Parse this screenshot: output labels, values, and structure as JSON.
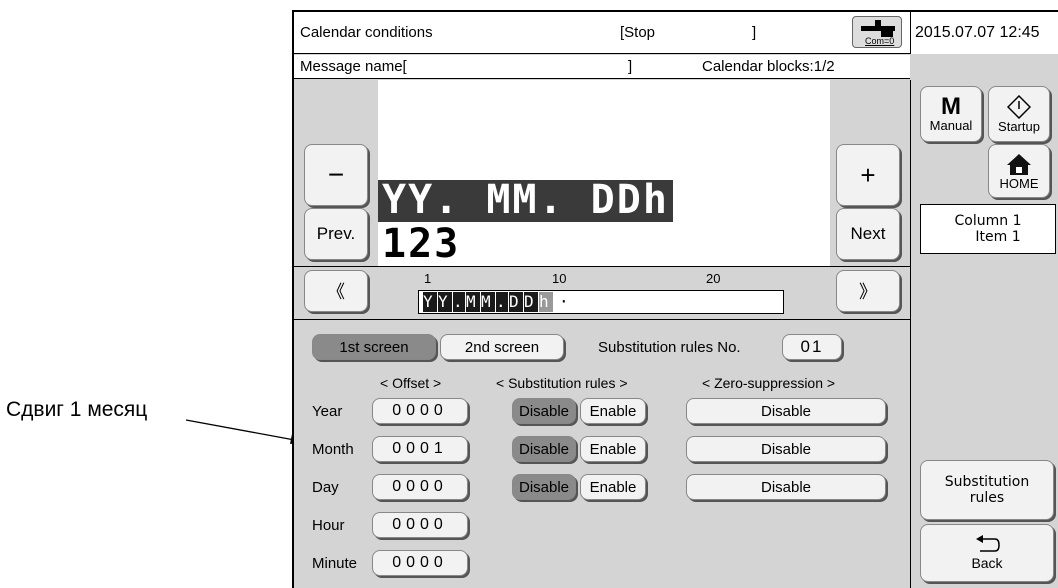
{
  "annotation": {
    "text": "Сдвиг 1 месяц"
  },
  "header": {
    "title": "Calendar conditions",
    "status": "[Stop",
    "status_close": "]",
    "com_label": "Com=0",
    "datetime": "2015.07.07 12:45"
  },
  "message_bar": {
    "message_name": "Message name[",
    "message_name_close": "]",
    "calendar_blocks": "Calendar blocks:1/2"
  },
  "preview": {
    "line1": "YY. MM. DDh",
    "line2": "123"
  },
  "nav_buttons": {
    "minus": "−",
    "plus": "+",
    "prev": "Prev.",
    "next": "Next",
    "scroll_left": "《",
    "scroll_right": "》"
  },
  "ruler": {
    "tick_1": "1",
    "tick_10": "10",
    "tick_20": "20",
    "dot": "·",
    "cells": [
      "Y",
      "Y",
      ".",
      "M",
      "M",
      ".",
      "D",
      "D",
      "h"
    ]
  },
  "tabs": {
    "first": "1st screen",
    "second": "2nd screen"
  },
  "substitution_no": {
    "label": "Substitution rules No.",
    "value": "01"
  },
  "columns": {
    "offset": "< Offset >",
    "substitution": "< Substitution rules >",
    "zero_suppression": "< Zero-suppression >"
  },
  "rows": [
    {
      "label": "Year",
      "offset": "0000",
      "disable": "Disable",
      "enable": "Enable",
      "zero": "Disable"
    },
    {
      "label": "Month",
      "offset": "0001",
      "disable": "Disable",
      "enable": "Enable",
      "zero": "Disable"
    },
    {
      "label": "Day",
      "offset": "0000",
      "disable": "Disable",
      "enable": "Enable",
      "zero": "Disable"
    },
    {
      "label": "Hour",
      "offset": "0000"
    },
    {
      "label": "Minute",
      "offset": "0000"
    }
  ],
  "right_panel": {
    "manual_letter": "M",
    "manual": "Manual",
    "startup": "Startup",
    "home": "HOME",
    "column": "Column 1",
    "item": "Item 1",
    "substitution_rules": "Substitution",
    "substitution_rules_2": "rules",
    "back": "Back"
  }
}
